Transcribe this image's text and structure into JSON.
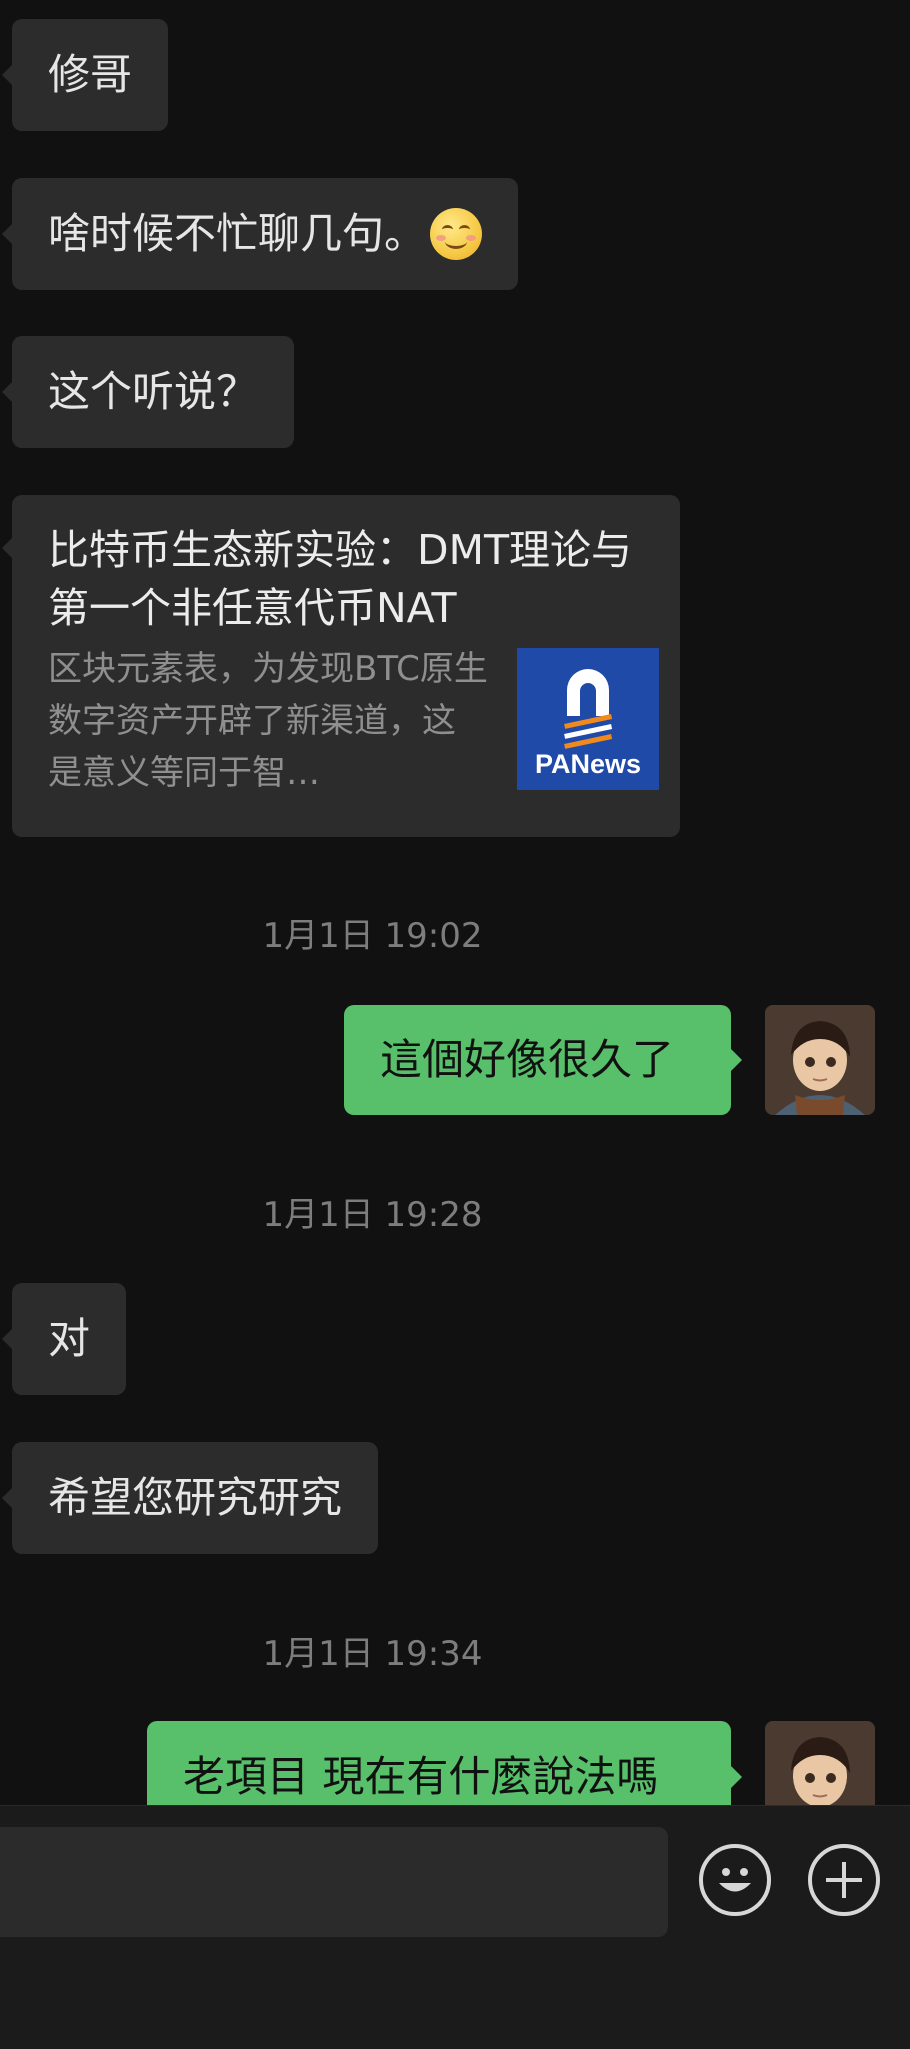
{
  "messages": {
    "m1": "修哥",
    "m2": "啥时候不忙聊几句。",
    "m2_emoji": "smiling-face-emoji",
    "m3": "这个听说？",
    "m4": "对",
    "m5": "希望您研究研究",
    "out1": "這個好像很久了",
    "out2": "老項目 現在有什麼說法嗎"
  },
  "link_card": {
    "title": "比特币生态新实验：DMT理论与第一个非任意代币NAT",
    "description": "区块元素表，为发现BTC原生数字资产开辟了新渠道，这是意义等同于智…",
    "thumb_brand": "PANews"
  },
  "timestamps": {
    "t1": "1月1日 19:02",
    "t2": "1月1日 19:28",
    "t3": "1月1日 19:34"
  },
  "input_bar": {
    "emoji_icon": "smiley-face-icon",
    "plus_icon": "plus-circle-icon"
  },
  "colors": {
    "background": "#111111",
    "incoming_bubble": "#2c2c2c",
    "outgoing_bubble": "#58bf6a"
  }
}
